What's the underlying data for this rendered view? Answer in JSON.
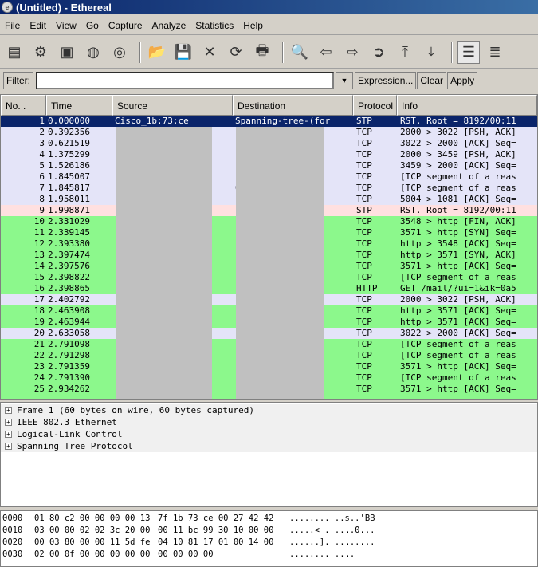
{
  "window": {
    "title": "(Untitled) - Ethereal",
    "icon": "ethereal-icon"
  },
  "menu": [
    "File",
    "Edit",
    "View",
    "Go",
    "Capture",
    "Analyze",
    "Statistics",
    "Help"
  ],
  "toolbar": [
    {
      "icon": "interfaces-icon",
      "g": "▤"
    },
    {
      "icon": "capture-options-icon",
      "g": "⚙"
    },
    {
      "icon": "start-capture-icon",
      "g": "▣"
    },
    {
      "icon": "stop-capture-icon",
      "g": "◍"
    },
    {
      "icon": "restart-capture-icon",
      "g": "◎"
    },
    {
      "sep": true
    },
    {
      "icon": "open-icon",
      "g": "📂"
    },
    {
      "icon": "save-icon",
      "g": "💾"
    },
    {
      "icon": "close-icon",
      "g": "✕"
    },
    {
      "icon": "reload-icon",
      "g": "⟳"
    },
    {
      "icon": "print-icon",
      "g": "🖶"
    },
    {
      "sep": true
    },
    {
      "icon": "find-packet-icon",
      "g": "🔍"
    },
    {
      "icon": "go-back-icon",
      "g": "⇦"
    },
    {
      "icon": "go-forward-icon",
      "g": "⇨"
    },
    {
      "icon": "go-to-packet-icon",
      "g": "➲"
    },
    {
      "icon": "first-packet-icon",
      "g": "⤒"
    },
    {
      "icon": "last-packet-icon",
      "g": "⤓"
    },
    {
      "sep": true
    },
    {
      "icon": "colorize-icon",
      "g": "☰",
      "pressed": true
    },
    {
      "icon": "auto-scroll-icon",
      "g": "≣"
    }
  ],
  "filter": {
    "label": "Filter:",
    "value": "",
    "expression": "Expression...",
    "clear": "Clear",
    "apply": "Apply"
  },
  "columns": [
    "No. .",
    "Time",
    "Source",
    "Destination",
    "Protocol",
    "Info"
  ],
  "colors": {
    "selected": "#0a246a",
    "tcp_other": "#e4e4f8",
    "stp_pink": "#ffe0e0",
    "http_green": "#8cf88c",
    "redacted": "#c0c0c0"
  },
  "packets": [
    {
      "no": "1",
      "time": "0.000000",
      "src": "Cisco_1b:73:ce",
      "dst": "Spanning-tree-(for",
      "proto": "STP",
      "info": "RST. Root = 8192/00:11",
      "color": "selected"
    },
    {
      "no": "2",
      "time": "0.392356",
      "src": "",
      "dst": "",
      "proto": "TCP",
      "info": "2000 > 3022 [PSH, ACK]",
      "color": "tcp_other"
    },
    {
      "no": "3",
      "time": "0.621519",
      "src": "",
      "dst": "",
      "proto": "TCP",
      "info": "3022 > 2000 [ACK] Seq=",
      "color": "tcp_other"
    },
    {
      "no": "4",
      "time": "1.375299",
      "src": "",
      "dst": "",
      "proto": "TCP",
      "info": "2000 > 3459 [PSH, ACK]",
      "color": "tcp_other"
    },
    {
      "no": "5",
      "time": "1.526186",
      "src": "",
      "dst": "",
      "proto": "TCP",
      "info": "3459 > 2000 [ACK] Seq=",
      "color": "tcp_other"
    },
    {
      "no": "6",
      "time": "1.845007",
      "src": "",
      "dst": "",
      "proto": "TCP",
      "info": "[TCP segment of a reas",
      "color": "tcp_other"
    },
    {
      "no": "7",
      "time": "1.845817",
      "src": "",
      "dst": "6",
      "proto": "TCP",
      "info": "[TCP segment of a reas",
      "color": "tcp_other"
    },
    {
      "no": "8",
      "time": "1.958011",
      "src": "",
      "dst": "",
      "proto": "TCP",
      "info": "5004 > 1081 [ACK] Seq=",
      "color": "tcp_other"
    },
    {
      "no": "9",
      "time": "1.998871",
      "src": "",
      "dst": "(for",
      "proto": "STP",
      "info": "RST. Root = 8192/00:11",
      "color": "stp_pink"
    },
    {
      "no": "10",
      "time": "2.331029",
      "src": "",
      "dst": "",
      "proto": "TCP",
      "info": "3548 > http [FIN, ACK]",
      "color": "http_green"
    },
    {
      "no": "11",
      "time": "2.339145",
      "src": "",
      "dst": "",
      "proto": "TCP",
      "info": "3571 > http [SYN] Seq=",
      "color": "http_green"
    },
    {
      "no": "12",
      "time": "2.393380",
      "src": "",
      "dst": "",
      "proto": "TCP",
      "info": "http > 3548 [ACK] Seq=",
      "color": "http_green"
    },
    {
      "no": "13",
      "time": "2.397474",
      "src": "",
      "dst": "",
      "proto": "TCP",
      "info": "http > 3571 [SYN, ACK]",
      "color": "http_green"
    },
    {
      "no": "14",
      "time": "2.397576",
      "src": "",
      "dst": "",
      "proto": "TCP",
      "info": "3571 > http [ACK] Seq=",
      "color": "http_green"
    },
    {
      "no": "15",
      "time": "2.398822",
      "src": "",
      "dst": "",
      "proto": "TCP",
      "info": "[TCP segment of a reas",
      "color": "http_green"
    },
    {
      "no": "16",
      "time": "2.398865",
      "src": "",
      "dst": "",
      "proto": "HTTP",
      "info": "GET /mail/?ui=1&ik=0a5",
      "color": "http_green"
    },
    {
      "no": "17",
      "time": "2.402792",
      "src": "",
      "dst": "",
      "proto": "TCP",
      "info": "2000 > 3022 [PSH, ACK]",
      "color": "tcp_other"
    },
    {
      "no": "18",
      "time": "2.463908",
      "src": "",
      "dst": "",
      "proto": "TCP",
      "info": "http > 3571 [ACK] Seq=",
      "color": "http_green"
    },
    {
      "no": "19",
      "time": "2.463944",
      "src": "",
      "dst": "",
      "proto": "TCP",
      "info": "http > 3571 [ACK] Seq=",
      "color": "http_green"
    },
    {
      "no": "20",
      "time": "2.633058",
      "src": "",
      "dst": "",
      "proto": "TCP",
      "info": "3022 > 2000 [ACK] Seq=",
      "color": "tcp_other"
    },
    {
      "no": "21",
      "time": "2.791098",
      "src": "",
      "dst": "",
      "proto": "TCP",
      "info": "[TCP segment of a reas",
      "color": "http_green"
    },
    {
      "no": "22",
      "time": "2.791298",
      "src": "",
      "dst": "",
      "proto": "TCP",
      "info": "[TCP segment of a reas",
      "color": "http_green"
    },
    {
      "no": "23",
      "time": "2.791359",
      "src": "",
      "dst": "",
      "proto": "TCP",
      "info": "3571 > http [ACK] Seq=",
      "color": "http_green"
    },
    {
      "no": "24",
      "time": "2.791390",
      "src": "",
      "dst": "",
      "proto": "TCP",
      "info": "[TCP segment of a reas",
      "color": "http_green"
    },
    {
      "no": "25",
      "time": "2.934262",
      "src": "",
      "dst": "",
      "proto": "TCP",
      "info": "3571 > http [ACK] Seq=",
      "color": "http_green"
    }
  ],
  "details": [
    "Frame 1 (60 bytes on wire, 60 bytes captured)",
    "IEEE 802.3 Ethernet",
    "Logical-Link Control",
    "Spanning Tree Protocol"
  ],
  "hex": [
    {
      "off": "0000",
      "b1": "01 80 c2 00 00 00 00 13",
      "b2": "7f 1b 73 ce 00 27 42 42",
      "ascii": "........ ..s..'BB"
    },
    {
      "off": "0010",
      "b1": "03 00 00 02 02 3c 20 00",
      "b2": "00 11 bc 99 30 10 00 00",
      "ascii": ".....< . ....0..."
    },
    {
      "off": "0020",
      "b1": "00 03 80 00 00 11 5d fe",
      "b2": "04 10 81 17 01 00 14 00",
      "ascii": "......]. ........"
    },
    {
      "off": "0030",
      "b1": "02 00 0f 00 00 00 00 00",
      "b2": "00 00 00 00",
      "ascii": "........ ...."
    }
  ]
}
